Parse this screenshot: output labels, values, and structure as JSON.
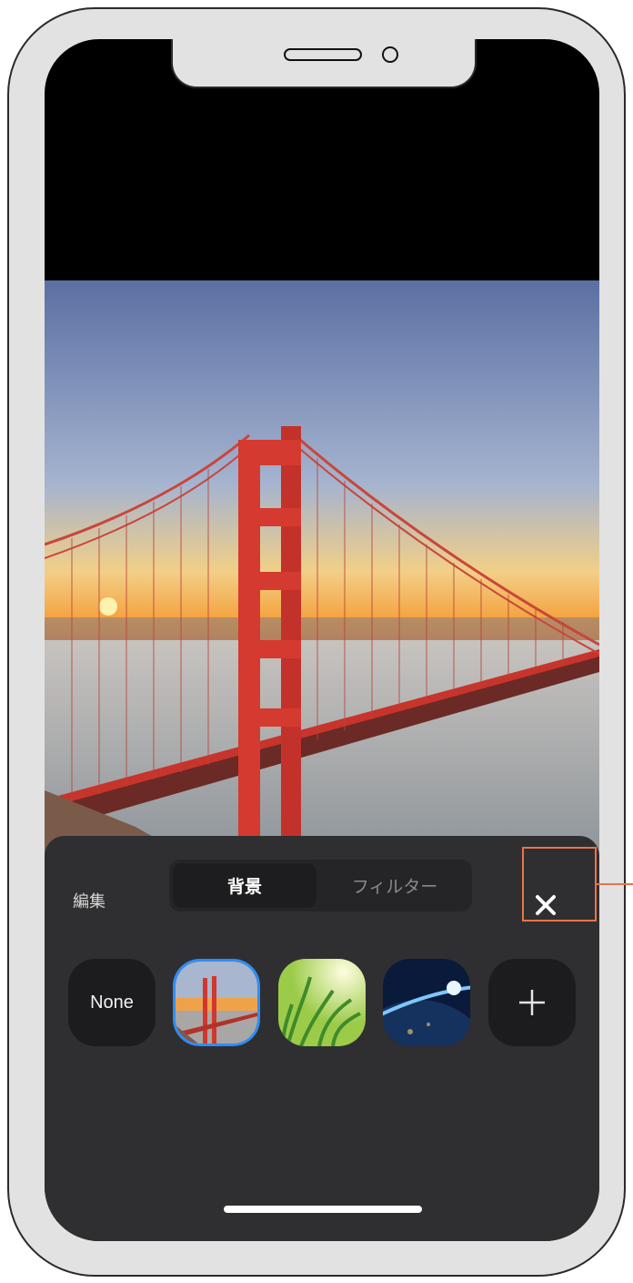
{
  "panel": {
    "edit_label": "編集",
    "tabs": [
      {
        "label": "背景",
        "selected": true
      },
      {
        "label": "フィルター",
        "selected": false
      }
    ],
    "close_icon": "close-icon"
  },
  "backgrounds": [
    {
      "label": "None",
      "kind": "none"
    },
    {
      "name": "golden-gate-bridge",
      "kind": "image",
      "selected": true
    },
    {
      "name": "grass",
      "kind": "image",
      "selected": false
    },
    {
      "name": "earth",
      "kind": "image",
      "selected": false
    },
    {
      "icon": "plus-icon",
      "kind": "add"
    }
  ],
  "colors": {
    "accent_selected": "#2f8df5",
    "highlight": "#e8744a",
    "panel_bg": "#2f2f31"
  }
}
